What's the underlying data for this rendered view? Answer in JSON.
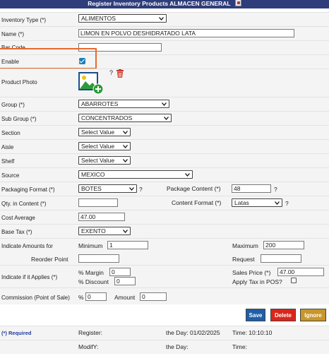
{
  "header": {
    "title": "Register Inventory Products ALMACEN GENERAL"
  },
  "form": {
    "inventory_type": {
      "label": "Inventory Type (*)",
      "value": "ALIMENTOS"
    },
    "name": {
      "label": "Name (*)",
      "value": "LIMON EN POLVO DESHIDRATADO LATA"
    },
    "bar_code": {
      "label": "Bar Code",
      "value": ""
    },
    "enable": {
      "label": "Enable",
      "checked": true
    },
    "product_photo": {
      "label": "Product Photo",
      "help": "?"
    },
    "group": {
      "label": "Group (*)",
      "value": "ABARROTES"
    },
    "sub_group": {
      "label": "Sub Group (*)",
      "value": "CONCENTRADOS"
    },
    "section": {
      "label": "Section",
      "value": "Select Value"
    },
    "aisle": {
      "label": "Aisle",
      "value": "Select Value"
    },
    "shelf": {
      "label": "Shelf",
      "value": "Select Value"
    },
    "source": {
      "label": "Source",
      "value": "MEXICO"
    },
    "packaging_format": {
      "label": "Packaging Format (*)",
      "value": "BOTES",
      "help": "?"
    },
    "package_content": {
      "label": "Package Content (*)",
      "value": "48",
      "help": "?"
    },
    "qty_in_content": {
      "label": "Qty. in Content (*)",
      "value": ""
    },
    "content_format": {
      "label": "Content Format (*)",
      "value": "Latas",
      "help": "?"
    },
    "cost_average": {
      "label": "Cost Average",
      "value": "47.00"
    },
    "base_tax": {
      "label": "Base Tax (*)",
      "value": "EXENTO"
    },
    "amounts": {
      "label": "Indicate Amounts for",
      "minimum_label": "Minimum",
      "minimum_value": "1",
      "maximum_label": "Maximum",
      "maximum_value": "200",
      "reorder_label": "Reorder Point",
      "reorder_value": "",
      "request_label": "Request",
      "request_value": ""
    },
    "applies": {
      "label": "Indicate if it Applies (*)",
      "margin_label": "% Margin",
      "margin_value": "0",
      "discount_label": "% Discount",
      "discount_value": "0",
      "sales_price_label": "Sales Price (*)",
      "sales_price_value": "47.00",
      "apply_tax_label": "Apply Tax in POS?"
    },
    "commission": {
      "label": "Commission (Point of Sale)",
      "percent_label": "%",
      "percent_value": "0",
      "amount_label": "Amount",
      "amount_value": "0"
    }
  },
  "buttons": {
    "save": "Save",
    "delete": "Delete",
    "ignore": "Ignore"
  },
  "footer": {
    "required": "(*) Required",
    "register_label": "Register:",
    "register_day": "the Day: 01/02/2025",
    "register_time": "Time: 10:10:10",
    "modify_label": "ModifY:",
    "modify_day": "the Day:",
    "modify_time": "Time:"
  },
  "colors": {
    "save": "#1e5fa8",
    "delete": "#d9261c",
    "ignore": "#c8962a",
    "title_bar": "#2f3d7a",
    "highlight": "#e8692b"
  }
}
